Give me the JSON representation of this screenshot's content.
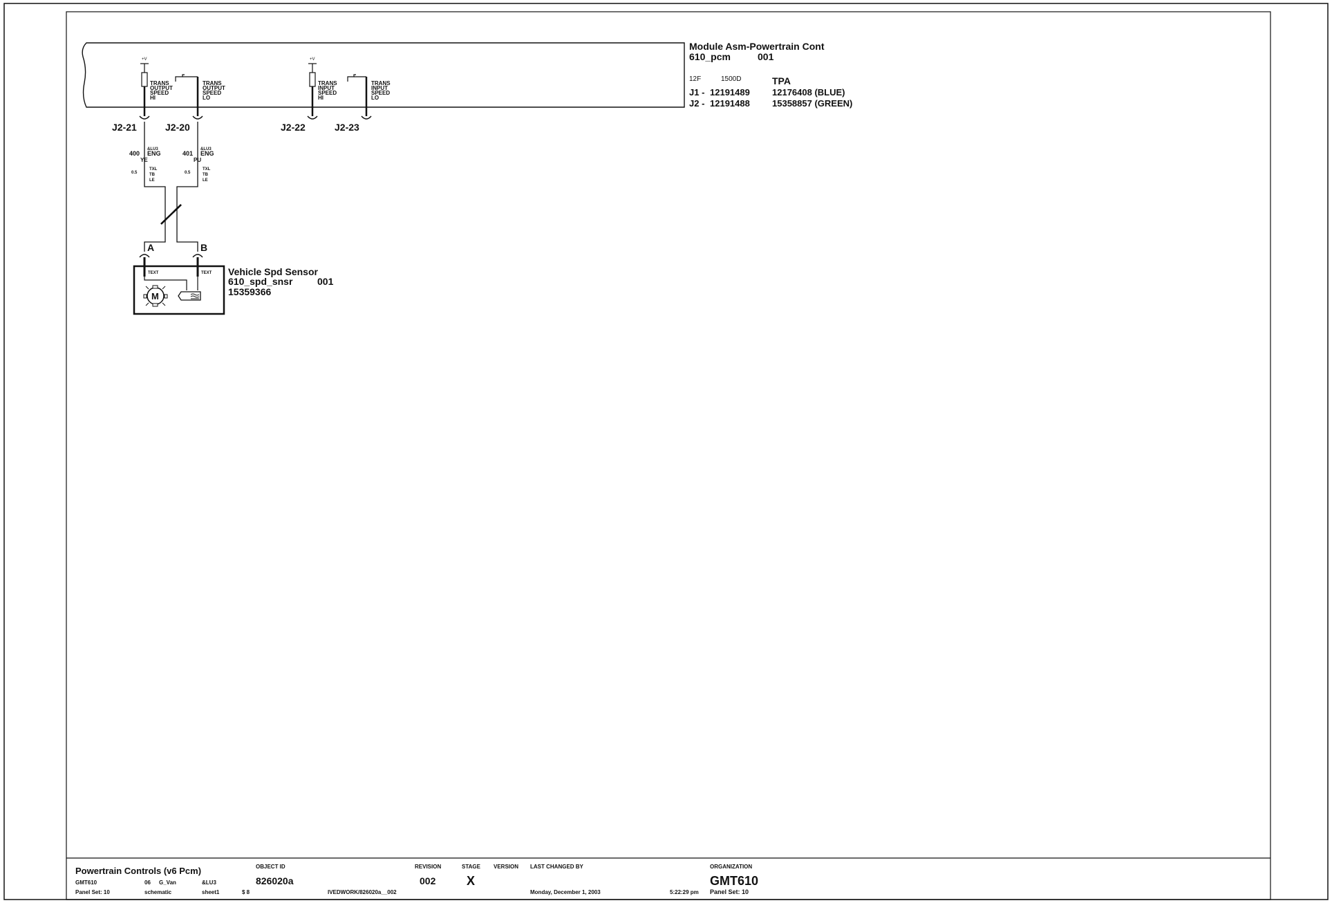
{
  "module": {
    "title": "Module Asm-Powertrain Cont",
    "id": "610_pcm",
    "code": "001",
    "f1": "12F",
    "f2": "1500D",
    "tpa": "TPA",
    "j1_label": "J1 -",
    "j1_part": "12191489",
    "j1_desc": "12176408 (BLUE)",
    "j2_label": "J2 -",
    "j2_part": "12191488",
    "j2_desc": "15358857 (GREEN)"
  },
  "circuits": [
    {
      "supply": "+V",
      "lines": [
        "TRANS",
        "OUTPUT",
        "SPEED",
        "HI"
      ],
      "pin": "J2-21",
      "wire": "400",
      "option": "&LU3",
      "option2": "ENG",
      "color": "YE",
      "gauge": "0.5",
      "insul": [
        "TXL",
        "TB",
        "LE"
      ]
    },
    {
      "lines": [
        "TRANS",
        "OUTPUT",
        "SPEED",
        "LO"
      ],
      "pin": "J2-20",
      "wire": "401",
      "option": "&LU3",
      "option2": "ENG",
      "color": "PU",
      "gauge": "0.5",
      "insul": [
        "TXL",
        "TB",
        "LE"
      ]
    },
    {
      "supply": "+V",
      "lines": [
        "TRANS",
        "INPUT",
        "SPEED",
        "HI"
      ],
      "pin": "J2-22"
    },
    {
      "lines": [
        "TRANS",
        "INPUT",
        "SPEED",
        "LO"
      ],
      "pin": "J2-23"
    }
  ],
  "sensor": {
    "title": "Vehicle Spd Sensor",
    "id": "610_spd_snsr",
    "code": "001",
    "part": "15359366",
    "pin_a": "A",
    "pin_b": "B",
    "term_a": "TEXT",
    "term_b": "TEXT",
    "motor": "M"
  },
  "title_block": {
    "title": "Powertrain Controls (v6 Pcm)",
    "vehicle": "GMT610",
    "year": "06",
    "body": "G_Van",
    "option": "&LU3",
    "panel_set": "Panel Set:  10",
    "type": "schematic",
    "sheet": "sheet1",
    "dollar": "$  8",
    "object_id_label": "OBJECT ID",
    "object_id": "826020a",
    "path": "IVEDWORK/826020a__002",
    "revision_label": "REVISION",
    "revision": "002",
    "stage_label": "STAGE",
    "stage": "X",
    "version_label": "VERSION",
    "last_changed_label": "LAST CHANGED BY",
    "date": "Monday, December 1, 2003",
    "time": "5:22:29 pm",
    "org_label": "ORGANIZATION",
    "org": "GMT610",
    "org_panel": "Panel Set: 10"
  }
}
